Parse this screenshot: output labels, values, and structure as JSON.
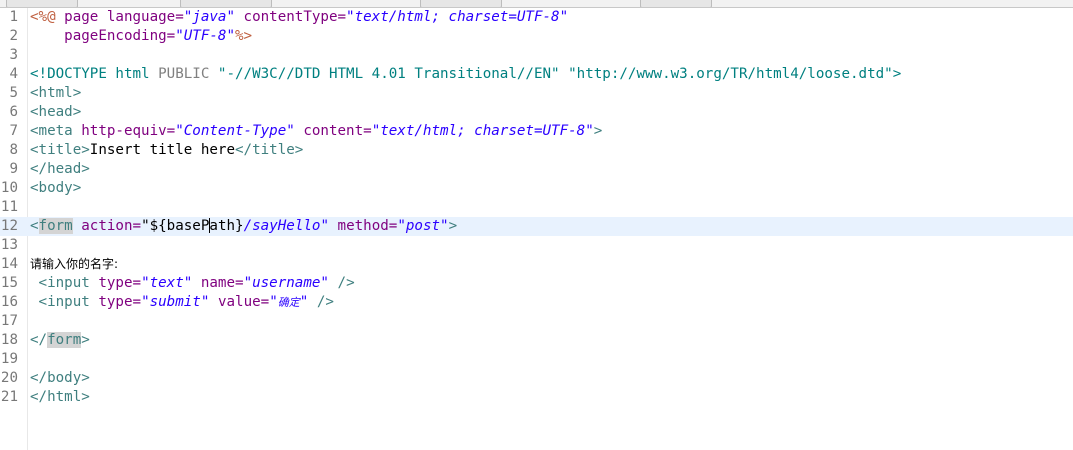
{
  "editor": {
    "language": "jsp",
    "current_line": 12,
    "lines": [
      {
        "num": "1",
        "tokens": [
          {
            "t": "<%@",
            "c": "directive"
          },
          {
            "t": " page ",
            "c": "attr"
          },
          {
            "t": "language=",
            "c": "attr"
          },
          {
            "t": "\"java\"",
            "c": "italic"
          },
          {
            "t": " contentType=",
            "c": "attr"
          },
          {
            "t": "\"text/html; charset=UTF-8\"",
            "c": "italic"
          }
        ]
      },
      {
        "num": "2",
        "tokens": [
          {
            "t": "    pageEncoding=",
            "c": "attr"
          },
          {
            "t": "\"UTF-8\"",
            "c": "italic"
          },
          {
            "t": "%>",
            "c": "directive"
          }
        ]
      },
      {
        "num": "3",
        "tokens": []
      },
      {
        "num": "4",
        "tokens": [
          {
            "t": "<!DOCTYPE html ",
            "c": "doctype"
          },
          {
            "t": "PUBLIC ",
            "c": "doctype-kw"
          },
          {
            "t": "\"-//W3C//DTD HTML 4.01 Transitional//EN\" \"http://www.w3.org/TR/html4/loose.dtd\"",
            "c": "doctype"
          },
          {
            "t": ">",
            "c": "doctype"
          }
        ]
      },
      {
        "num": "5",
        "tokens": [
          {
            "t": "<html>",
            "c": "tag"
          }
        ]
      },
      {
        "num": "6",
        "tokens": [
          {
            "t": "<head>",
            "c": "tag"
          }
        ]
      },
      {
        "num": "7",
        "tokens": [
          {
            "t": "<meta ",
            "c": "tag"
          },
          {
            "t": "http-equiv=",
            "c": "attr"
          },
          {
            "t": "\"Content-Type\"",
            "c": "italic"
          },
          {
            "t": " content=",
            "c": "attr"
          },
          {
            "t": "\"text/html; charset=UTF-8\"",
            "c": "italic"
          },
          {
            "t": ">",
            "c": "tag"
          }
        ]
      },
      {
        "num": "8",
        "tokens": [
          {
            "t": "<title>",
            "c": "tag"
          },
          {
            "t": "Insert title here",
            "c": "plain"
          },
          {
            "t": "</title>",
            "c": "tag"
          }
        ]
      },
      {
        "num": "9",
        "tokens": [
          {
            "t": "</head>",
            "c": "tag"
          }
        ]
      },
      {
        "num": "10",
        "tokens": [
          {
            "t": "<body>",
            "c": "tag"
          }
        ]
      },
      {
        "num": "11",
        "tokens": []
      },
      {
        "num": "12",
        "tokens": [
          {
            "t": "<",
            "c": "tag"
          },
          {
            "t": "form",
            "c": "tag hl"
          },
          {
            "t": " action=",
            "c": "attr"
          },
          {
            "t": "\"${baseP",
            "c": "plain"
          },
          {
            "t": "|",
            "c": "caret"
          },
          {
            "t": "ath}",
            "c": "plain"
          },
          {
            "t": "/sayHello\"",
            "c": "italic"
          },
          {
            "t": " method=",
            "c": "attr"
          },
          {
            "t": "\"post\"",
            "c": "italic"
          },
          {
            "t": ">",
            "c": "tag"
          }
        ]
      },
      {
        "num": "13",
        "tokens": []
      },
      {
        "num": "14",
        "tokens": [
          {
            "t": "请输入你的名字:",
            "c": "cjk"
          }
        ]
      },
      {
        "num": "15",
        "tokens": [
          {
            "t": " <input ",
            "c": "tag"
          },
          {
            "t": "type=",
            "c": "attr"
          },
          {
            "t": "\"text\"",
            "c": "italic"
          },
          {
            "t": " name=",
            "c": "attr"
          },
          {
            "t": "\"username\"",
            "c": "italic"
          },
          {
            "t": " />",
            "c": "tag"
          }
        ]
      },
      {
        "num": "16",
        "tokens": [
          {
            "t": " <input ",
            "c": "tag"
          },
          {
            "t": "type=",
            "c": "attr"
          },
          {
            "t": "\"submit\"",
            "c": "italic"
          },
          {
            "t": " value=",
            "c": "attr"
          },
          {
            "t": "\"",
            "c": "italic"
          },
          {
            "t": "确定",
            "c": "cjk-italic"
          },
          {
            "t": "\"",
            "c": "italic"
          },
          {
            "t": " />",
            "c": "tag"
          }
        ]
      },
      {
        "num": "17",
        "tokens": []
      },
      {
        "num": "18",
        "tokens": [
          {
            "t": "</",
            "c": "tag"
          },
          {
            "t": "form",
            "c": "tag hl"
          },
          {
            "t": ">",
            "c": "tag"
          }
        ]
      },
      {
        "num": "19",
        "tokens": []
      },
      {
        "num": "20",
        "tokens": [
          {
            "t": "</body>",
            "c": "tag"
          }
        ]
      },
      {
        "num": "21",
        "tokens": [
          {
            "t": "</html>",
            "c": "tag"
          }
        ]
      }
    ]
  },
  "colors": {
    "directive": "#bf5f3f",
    "attribute": "#7f007f",
    "string": "#2a00ff",
    "tag": "#3f7f7f",
    "current_line_bg": "#e8f2fe",
    "line_number": "#787878"
  }
}
